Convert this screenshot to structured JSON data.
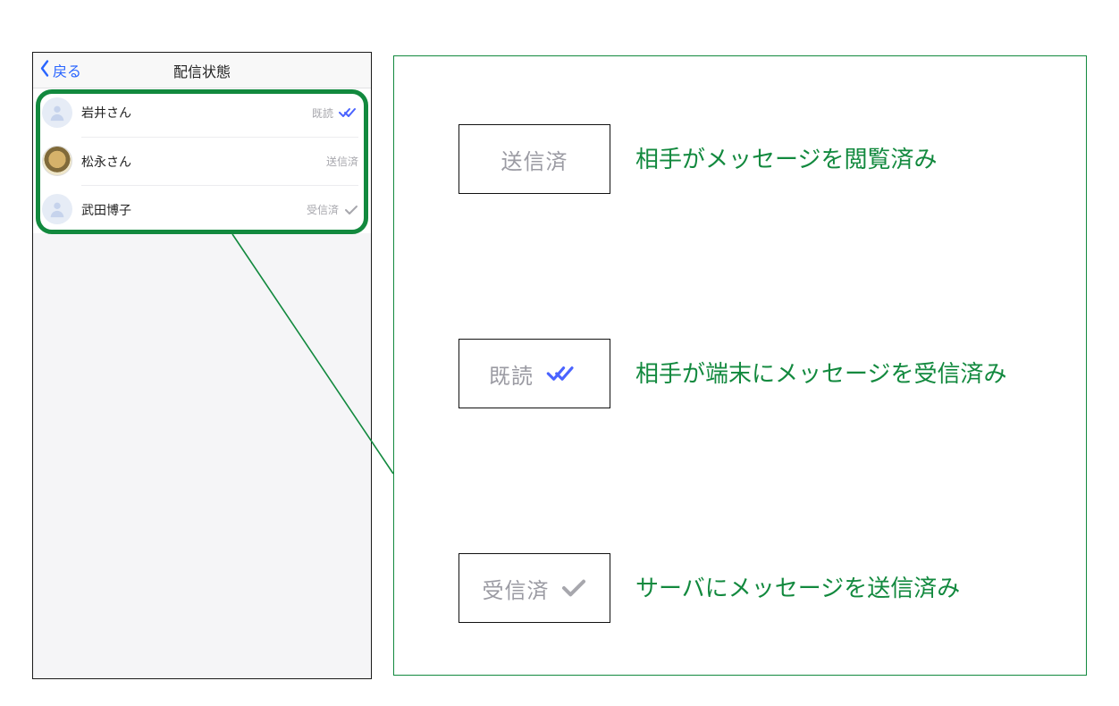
{
  "phone": {
    "back_label": "戻る",
    "title": "配信状態",
    "rows": [
      {
        "name": "岩井さん",
        "status_label": "既読",
        "icon": "double-check-blue",
        "avatar": "placeholder"
      },
      {
        "name": "松永さん",
        "status_label": "送信済",
        "icon": "",
        "avatar": "photo"
      },
      {
        "name": "武田博子",
        "status_label": "受信済",
        "icon": "single-check-gray",
        "avatar": "placeholder"
      }
    ]
  },
  "legend": {
    "items": [
      {
        "badge_text": "送信済",
        "badge_icon": "",
        "description": "相手がメッセージを閲覧済み"
      },
      {
        "badge_text": "既読",
        "badge_icon": "double-check-blue",
        "description": "相手が端末にメッセージを受信済み"
      },
      {
        "badge_text": "受信済",
        "badge_icon": "single-check-gray",
        "description": "サーバにメッセージを送信済み"
      }
    ]
  },
  "colors": {
    "accent_green": "#12893e",
    "link_blue": "#2965ff",
    "tick_blue": "#4a63ff",
    "muted_gray": "#9b9ba3"
  }
}
